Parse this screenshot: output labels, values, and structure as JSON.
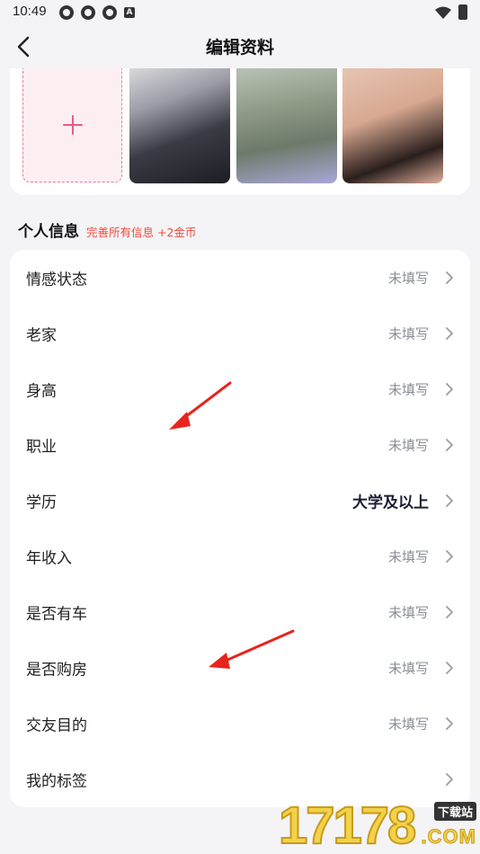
{
  "status_bar": {
    "time": "10:49",
    "badge_letter": "A"
  },
  "nav": {
    "title": "编辑资料"
  },
  "photos": {
    "add_icon": "plus-icon",
    "thumbnails": [
      "anime-character-photo",
      "cat-in-flowers-photo",
      "woman-portrait-photo"
    ]
  },
  "section": {
    "title": "个人信息",
    "hint": "完善所有信息 +2金币"
  },
  "rows": [
    {
      "label": "情感状态",
      "value": "未填写",
      "filled": false
    },
    {
      "label": "老家",
      "value": "未填写",
      "filled": false
    },
    {
      "label": "身高",
      "value": "未填写",
      "filled": false
    },
    {
      "label": "职业",
      "value": "未填写",
      "filled": false
    },
    {
      "label": "学历",
      "value": "大学及以上",
      "filled": true
    },
    {
      "label": "年收入",
      "value": "未填写",
      "filled": false
    },
    {
      "label": "是否有车",
      "value": "未填写",
      "filled": false
    },
    {
      "label": "是否购房",
      "value": "未填写",
      "filled": false
    },
    {
      "label": "交友目的",
      "value": "未填写",
      "filled": false
    },
    {
      "label": "我的标签",
      "value": "",
      "filled": false
    }
  ],
  "watermark": {
    "number": "17178",
    "tag": "下载站",
    "domain": ".COM"
  },
  "colors": {
    "accent_pink": "#e85a86",
    "hint_red": "#ef4b3c",
    "annotation_red": "#e8241c"
  }
}
